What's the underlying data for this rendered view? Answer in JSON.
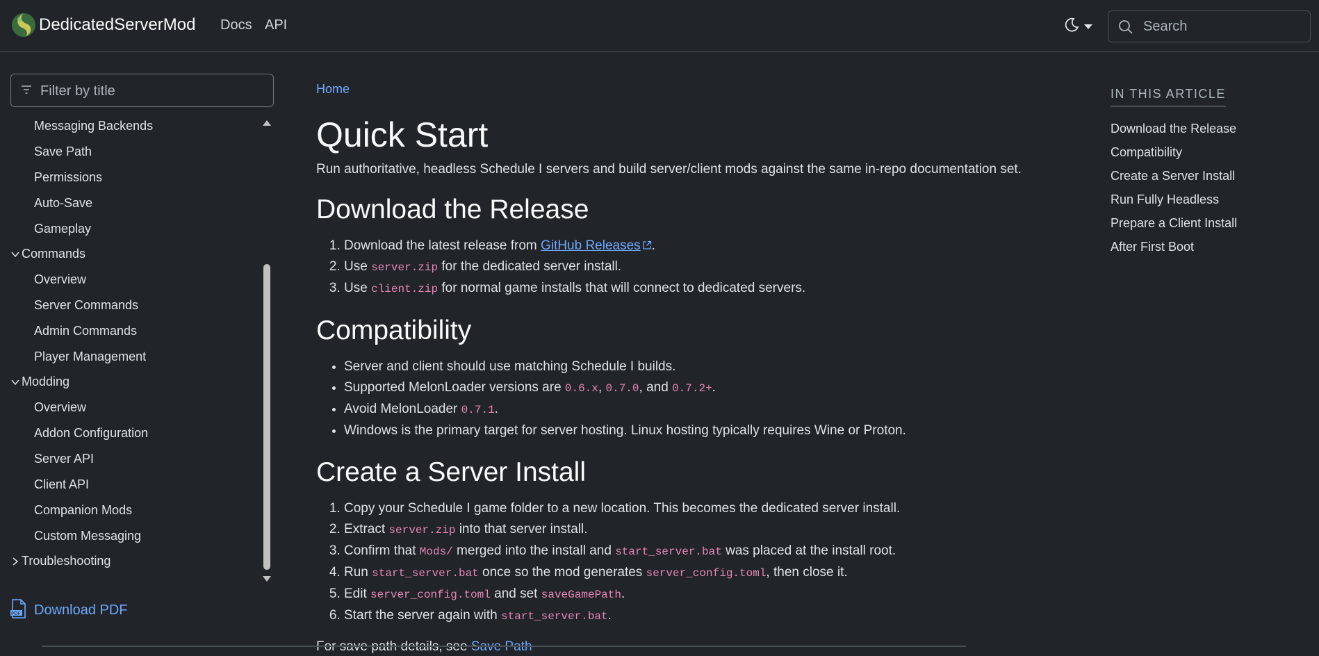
{
  "header": {
    "brand": "DedicatedServerMod",
    "nav": [
      "Docs",
      "API"
    ],
    "search_placeholder": "Search"
  },
  "sidebar": {
    "filter_placeholder": "Filter by title",
    "items": [
      {
        "label": "Messaging Backends",
        "type": "child"
      },
      {
        "label": "Save Path",
        "type": "child"
      },
      {
        "label": "Permissions",
        "type": "child"
      },
      {
        "label": "Auto-Save",
        "type": "child"
      },
      {
        "label": "Gameplay",
        "type": "child"
      },
      {
        "label": "Commands",
        "type": "group",
        "expanded": true
      },
      {
        "label": "Overview",
        "type": "child"
      },
      {
        "label": "Server Commands",
        "type": "child"
      },
      {
        "label": "Admin Commands",
        "type": "child"
      },
      {
        "label": "Player Management",
        "type": "child"
      },
      {
        "label": "Modding",
        "type": "group",
        "expanded": true
      },
      {
        "label": "Overview",
        "type": "child"
      },
      {
        "label": "Addon Configuration",
        "type": "child"
      },
      {
        "label": "Server API",
        "type": "child"
      },
      {
        "label": "Client API",
        "type": "child"
      },
      {
        "label": "Companion Mods",
        "type": "child"
      },
      {
        "label": "Custom Messaging",
        "type": "child"
      },
      {
        "label": "Troubleshooting",
        "type": "group",
        "expanded": false
      }
    ],
    "download_pdf": "Download PDF"
  },
  "article": {
    "breadcrumb": "Home",
    "title": "Quick Start",
    "lead": "Run authoritative, headless Schedule I servers and build server/client mods against the same in-repo documentation set.",
    "sections": {
      "download": {
        "heading": "Download the Release",
        "i1_pre": "Download the latest release from ",
        "i1_link": "GitHub Releases",
        "i1_post": ".",
        "i2_pre": "Use ",
        "i2_code": "server.zip",
        "i2_post": " for the dedicated server install.",
        "i3_pre": "Use ",
        "i3_code": "client.zip",
        "i3_post": " for normal game installs that will connect to dedicated servers."
      },
      "compat": {
        "heading": "Compatibility",
        "i1": "Server and client should use matching Schedule I builds.",
        "i2_pre": "Supported MelonLoader versions are ",
        "i2_c1": "0.6.x",
        "i2_sep1": ", ",
        "i2_c2": "0.7.0",
        "i2_sep2": ", and ",
        "i2_c3": "0.7.2+",
        "i2_post": ".",
        "i3_pre": "Avoid MelonLoader ",
        "i3_code": "0.7.1",
        "i3_post": ".",
        "i4": "Windows is the primary target for server hosting. Linux hosting typically requires Wine or Proton."
      },
      "install": {
        "heading": "Create a Server Install",
        "i1": "Copy your Schedule I game folder to a new location. This becomes the dedicated server install.",
        "i2_pre": "Extract ",
        "i2_code": "server.zip",
        "i2_post": " into that server install.",
        "i3_pre": "Confirm that ",
        "i3_c1": "Mods/",
        "i3_mid": " merged into the install and ",
        "i3_c2": "start_server.bat",
        "i3_post": " was placed at the install root.",
        "i4_pre": "Run ",
        "i4_c1": "start_server.bat",
        "i4_mid": " once so the mod generates ",
        "i4_c2": "server_config.toml",
        "i4_post": ", then close it.",
        "i5_pre": "Edit ",
        "i5_c1": "server_config.toml",
        "i5_mid": " and set ",
        "i5_c2": "saveGamePath",
        "i5_post": ".",
        "i6_pre": "Start the server again with ",
        "i6_code": "start_server.bat",
        "i6_post": "."
      },
      "footer_pre": "For save path details, see ",
      "footer_link": "Save Path"
    }
  },
  "in_this_article": {
    "title": "IN THIS ARTICLE",
    "links": [
      "Download the Release",
      "Compatibility",
      "Create a Server Install",
      "Run Fully Headless",
      "Prepare a Client Install",
      "After First Boot"
    ]
  },
  "colors": {
    "background": "#212529",
    "link": "#6ea8fe",
    "code": "#e685b5"
  }
}
